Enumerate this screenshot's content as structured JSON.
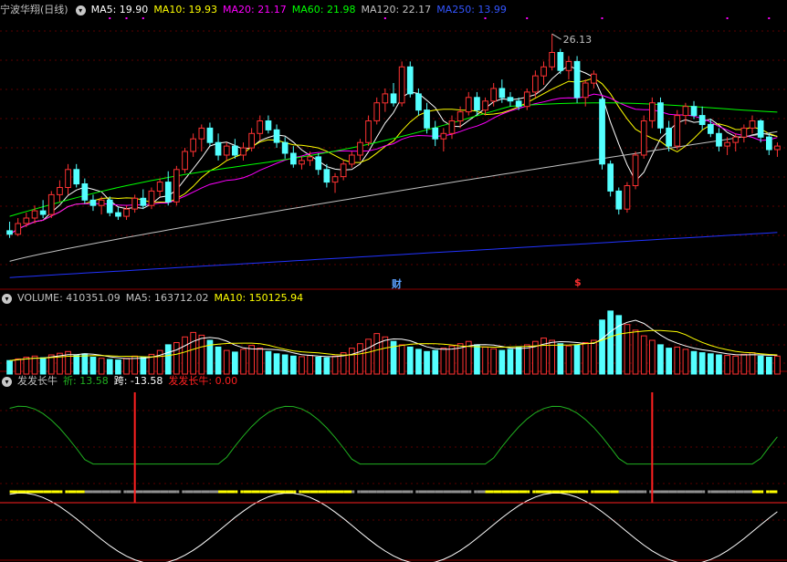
{
  "chart_data": [
    {
      "panel": "price",
      "type": "candlestick",
      "stock_title": "宁波华翔(日线)",
      "ma": [
        {
          "name": "MA5",
          "label": "MA5: 19.90",
          "color": "#ffffff"
        },
        {
          "name": "MA10",
          "label": "MA10: 19.93",
          "color": "#ffff00"
        },
        {
          "name": "MA20",
          "label": "MA20: 21.17",
          "color": "#ff00ff"
        },
        {
          "name": "MA60",
          "label": "MA60: 21.98",
          "color": "#00ff00"
        },
        {
          "name": "MA120",
          "label": "MA120: 22.17",
          "color": "#c0c0c0"
        },
        {
          "name": "MA250",
          "label": "MA250: 13.99",
          "color": "#0000ff"
        }
      ],
      "peak_label": "26.13",
      "badges": [
        "财",
        "$"
      ],
      "ylim": [
        12,
        27
      ],
      "up_color": "#ff3232",
      "down_color": "#54ffff",
      "candles": [
        [
          15.2,
          15.7,
          14.8,
          15.0
        ],
        [
          15.0,
          15.9,
          14.9,
          15.6
        ],
        [
          15.6,
          16.2,
          15.4,
          15.9
        ],
        [
          15.9,
          16.6,
          15.6,
          16.3
        ],
        [
          16.3,
          16.9,
          15.9,
          16.1
        ],
        [
          16.1,
          17.4,
          15.9,
          17.2
        ],
        [
          17.2,
          18.0,
          16.8,
          17.6
        ],
        [
          17.6,
          18.9,
          17.2,
          18.6
        ],
        [
          18.6,
          18.9,
          17.6,
          17.8
        ],
        [
          17.8,
          18.1,
          16.7,
          16.9
        ],
        [
          16.9,
          17.2,
          16.3,
          16.6
        ],
        [
          16.6,
          17.1,
          16.1,
          16.9
        ],
        [
          16.9,
          17.1,
          16.0,
          16.2
        ],
        [
          16.2,
          16.5,
          15.8,
          16.0
        ],
        [
          16.0,
          16.6,
          15.8,
          16.4
        ],
        [
          16.4,
          17.2,
          16.2,
          17.0
        ],
        [
          17.0,
          17.5,
          16.4,
          16.6
        ],
        [
          16.6,
          17.6,
          16.4,
          17.4
        ],
        [
          17.4,
          18.1,
          17.1,
          17.9
        ],
        [
          17.9,
          18.5,
          16.6,
          16.8
        ],
        [
          16.8,
          18.8,
          16.6,
          18.6
        ],
        [
          18.6,
          19.8,
          18.4,
          19.6
        ],
        [
          19.6,
          20.6,
          19.3,
          20.3
        ],
        [
          20.3,
          21.1,
          19.6,
          20.9
        ],
        [
          20.9,
          21.2,
          19.9,
          20.1
        ],
        [
          20.1,
          20.6,
          19.1,
          19.4
        ],
        [
          19.4,
          20.1,
          19.1,
          19.9
        ],
        [
          19.9,
          20.3,
          19.2,
          19.4
        ],
        [
          19.4,
          20.1,
          19.1,
          19.8
        ],
        [
          19.8,
          20.9,
          19.6,
          20.6
        ],
        [
          20.6,
          21.6,
          20.2,
          21.3
        ],
        [
          21.3,
          21.6,
          20.6,
          20.8
        ],
        [
          20.8,
          21.1,
          19.8,
          20.1
        ],
        [
          20.1,
          20.4,
          19.2,
          19.5
        ],
        [
          19.5,
          19.9,
          18.7,
          18.9
        ],
        [
          18.9,
          19.3,
          18.6,
          19.1
        ],
        [
          19.1,
          19.6,
          18.8,
          19.3
        ],
        [
          19.3,
          19.5,
          18.3,
          18.6
        ],
        [
          18.6,
          18.9,
          17.6,
          17.9
        ],
        [
          17.9,
          18.4,
          17.3,
          18.2
        ],
        [
          18.2,
          19.1,
          18.0,
          18.9
        ],
        [
          18.9,
          19.6,
          18.7,
          19.4
        ],
        [
          19.4,
          20.3,
          19.1,
          20.1
        ],
        [
          20.1,
          21.6,
          19.9,
          21.3
        ],
        [
          21.3,
          22.6,
          21.1,
          22.3
        ],
        [
          22.3,
          23.1,
          21.8,
          22.8
        ],
        [
          22.8,
          23.4,
          22.1,
          22.3
        ],
        [
          22.3,
          24.6,
          22.1,
          24.3
        ],
        [
          24.3,
          24.6,
          22.6,
          22.8
        ],
        [
          22.8,
          23.1,
          21.6,
          21.9
        ],
        [
          21.9,
          22.3,
          20.6,
          20.9
        ],
        [
          20.9,
          21.3,
          19.9,
          20.3
        ],
        [
          20.3,
          20.9,
          19.6,
          20.6
        ],
        [
          20.6,
          21.6,
          20.3,
          21.3
        ],
        [
          21.3,
          22.1,
          20.9,
          21.8
        ],
        [
          21.8,
          22.9,
          21.6,
          22.6
        ],
        [
          22.6,
          22.9,
          21.6,
          21.9
        ],
        [
          21.9,
          22.6,
          21.6,
          22.4
        ],
        [
          22.4,
          23.4,
          22.1,
          23.1
        ],
        [
          23.1,
          23.6,
          22.3,
          22.6
        ],
        [
          22.6,
          22.9,
          22.1,
          22.4
        ],
        [
          22.4,
          22.6,
          21.9,
          22.1
        ],
        [
          22.1,
          23.1,
          21.9,
          22.9
        ],
        [
          22.9,
          24.1,
          22.6,
          23.8
        ],
        [
          23.8,
          24.6,
          23.3,
          24.3
        ],
        [
          24.3,
          26.13,
          24.1,
          25.1
        ],
        [
          25.1,
          25.3,
          23.9,
          24.1
        ],
        [
          24.1,
          24.9,
          23.6,
          24.6
        ],
        [
          24.6,
          24.9,
          22.3,
          22.6
        ],
        [
          22.6,
          23.6,
          22.1,
          23.4
        ],
        [
          23.4,
          24.1,
          23.1,
          23.9
        ],
        [
          22.5,
          22.6,
          18.6,
          18.9
        ],
        [
          18.9,
          19.1,
          17.1,
          17.4
        ],
        [
          17.4,
          17.6,
          16.1,
          16.4
        ],
        [
          16.4,
          17.9,
          16.2,
          17.7
        ],
        [
          17.7,
          19.6,
          17.5,
          19.4
        ],
        [
          19.4,
          21.6,
          19.2,
          21.3
        ],
        [
          21.3,
          22.6,
          20.9,
          22.3
        ],
        [
          22.3,
          22.6,
          20.6,
          20.9
        ],
        [
          20.9,
          21.3,
          19.6,
          19.9
        ],
        [
          19.9,
          21.9,
          19.7,
          21.6
        ],
        [
          21.6,
          22.3,
          21.1,
          22.1
        ],
        [
          22.1,
          22.4,
          21.4,
          21.6
        ],
        [
          21.6,
          22.1,
          20.8,
          21.1
        ],
        [
          21.1,
          21.4,
          20.4,
          20.6
        ],
        [
          20.6,
          20.9,
          19.6,
          19.9
        ],
        [
          19.9,
          20.4,
          19.4,
          20.1
        ],
        [
          20.1,
          20.6,
          19.6,
          20.4
        ],
        [
          20.4,
          21.1,
          20.1,
          20.9
        ],
        [
          20.9,
          21.6,
          20.6,
          21.3
        ],
        [
          21.3,
          21.4,
          20.1,
          20.4
        ],
        [
          20.4,
          20.6,
          19.4,
          19.7
        ],
        [
          19.7,
          20.1,
          19.3,
          19.9
        ]
      ]
    },
    {
      "panel": "volume",
      "type": "bar",
      "header": {
        "title": "VOLUME: 410351.09",
        "ma5": "MA5: 163712.02",
        "ma10": "MA10: 150125.94"
      },
      "values": [
        120,
        135,
        150,
        160,
        145,
        170,
        185,
        200,
        165,
        180,
        150,
        140,
        130,
        125,
        140,
        160,
        150,
        175,
        210,
        260,
        280,
        330,
        370,
        345,
        300,
        240,
        210,
        195,
        220,
        255,
        230,
        200,
        180,
        170,
        160,
        155,
        165,
        150,
        145,
        160,
        190,
        230,
        270,
        310,
        360,
        330,
        290,
        260,
        240,
        220,
        200,
        210,
        230,
        250,
        270,
        290,
        260,
        240,
        225,
        210,
        220,
        240,
        260,
        290,
        320,
        300,
        270,
        250,
        260,
        280,
        300,
        480,
        560,
        520,
        440,
        390,
        340,
        300,
        260,
        230,
        240,
        220,
        200,
        190,
        180,
        170,
        165,
        160,
        175,
        190,
        160,
        150,
        160
      ],
      "ylim": [
        0,
        600
      ]
    },
    {
      "panel": "indicator",
      "type": "line",
      "header": {
        "title": "发发长牛",
        "qi": "祈: 13.58",
        "kua": "跨: -13.58",
        "fafa": "发发长牛: 0.00"
      },
      "signals_at_index": [
        15,
        77
      ],
      "ylim": [
        -20,
        20
      ]
    }
  ]
}
